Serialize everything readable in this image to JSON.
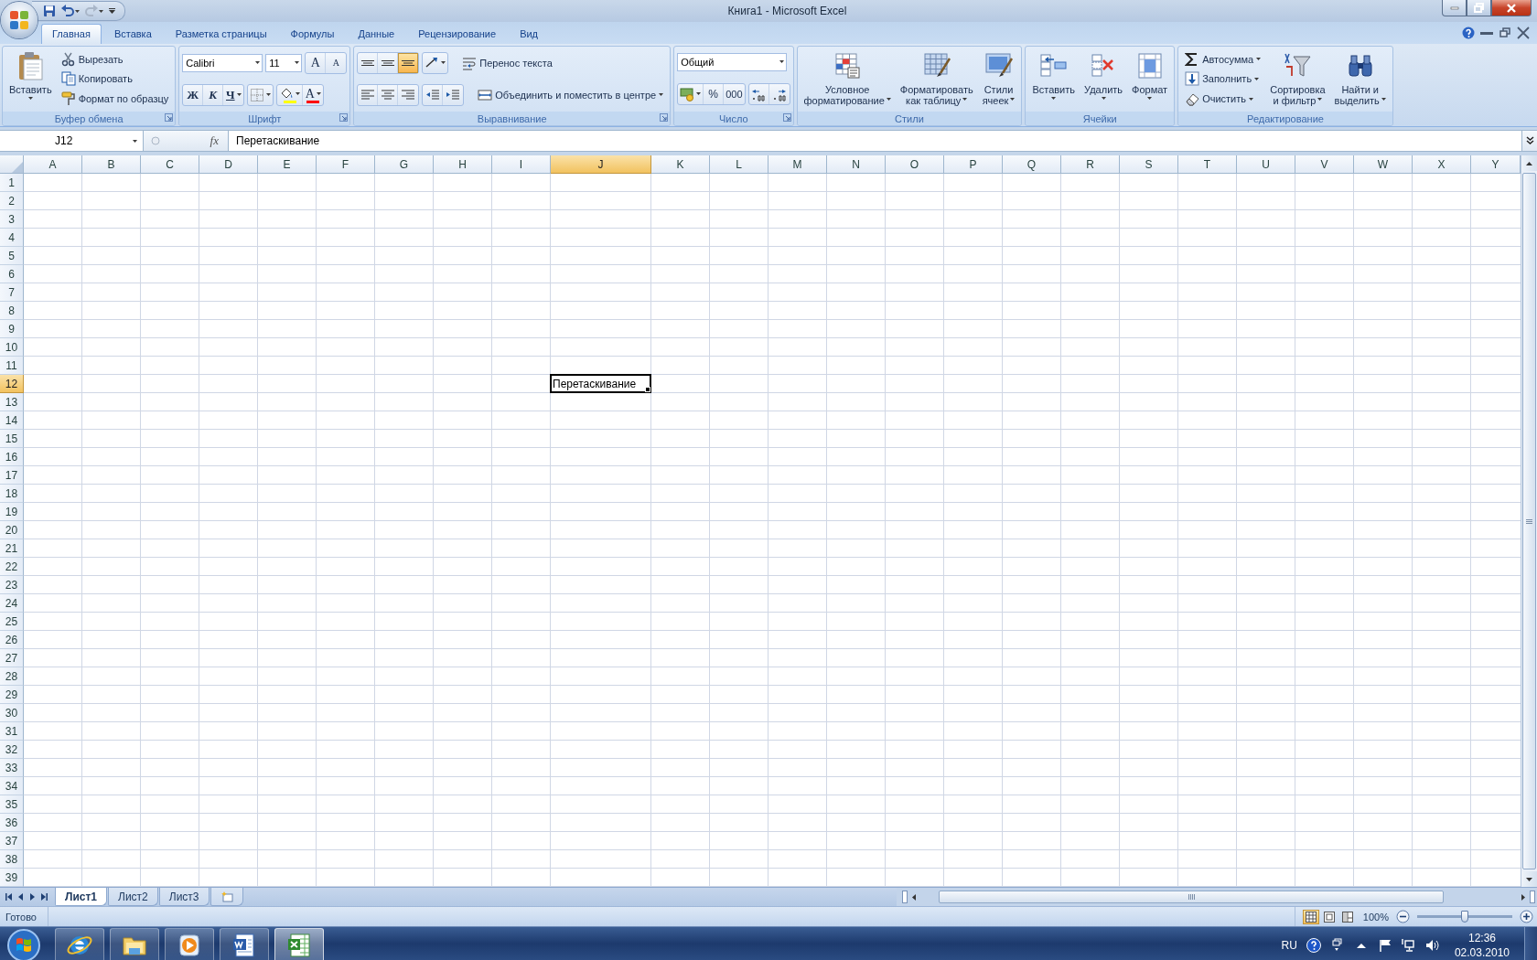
{
  "window": {
    "title": "Книга1 - Microsoft Excel"
  },
  "quick_access": [
    {
      "kind": "save",
      "dropdown": false,
      "disabled": false
    },
    {
      "kind": "undo",
      "dropdown": true,
      "disabled": false
    },
    {
      "kind": "redo",
      "dropdown": true,
      "disabled": true
    }
  ],
  "ribbon_tabs": [
    {
      "label": "Главная",
      "selected": true
    },
    {
      "label": "Вставка",
      "selected": false
    },
    {
      "label": "Разметка страницы",
      "selected": false
    },
    {
      "label": "Формулы",
      "selected": false
    },
    {
      "label": "Данные",
      "selected": false
    },
    {
      "label": "Рецензирование",
      "selected": false
    },
    {
      "label": "Вид",
      "selected": false
    }
  ],
  "ribbon_groups": [
    {
      "label": "Буфер обмена",
      "launcher": true,
      "sections": [
        {
          "kind": "large",
          "lines": [
            "Вставить"
          ],
          "dropdown": true
        },
        {
          "kind": "stack",
          "items": [
            {
              "label": "Вырезать",
              "dropdown": false
            },
            {
              "label": "Копировать",
              "dropdown": false
            },
            {
              "label": "Формат по образцу",
              "dropdown": false
            }
          ]
        }
      ]
    },
    {
      "label": "Шрифт",
      "launcher": true,
      "sections": [
        {
          "kind": "rows",
          "rows": [
            [
              {
                "kind": "combo",
                "value": "Calibri"
              },
              {
                "kind": "combo",
                "value": "11"
              },
              {
                "kind": "tools",
                "tools": [
                  {
                    "text": "A",
                    "dropdown": false,
                    "selected": false
                  },
                  {
                    "text": "A",
                    "dropdown": false,
                    "selected": false
                  }
                ]
              }
            ],
            [
              {
                "kind": "tools",
                "tools": [
                  {
                    "text": "Ж",
                    "dropdown": false,
                    "selected": false
                  },
                  {
                    "text": "К",
                    "dropdown": false,
                    "selected": false
                  },
                  {
                    "text": "Ч",
                    "dropdown": true,
                    "selected": false
                  }
                ]
              },
              {
                "kind": "tools",
                "tools": [
                  {
                    "dropdown": true,
                    "selected": false
                  }
                ]
              },
              {
                "kind": "tools",
                "tools": [
                  {
                    "dropdown": true,
                    "selected": false,
                    "color": "#ffff00"
                  },
                  {
                    "text": "A",
                    "dropdown": true,
                    "selected": false,
                    "color": "#ff0000"
                  }
                ]
              }
            ]
          ]
        }
      ]
    },
    {
      "label": "Выравнивание",
      "launcher": true,
      "sections": [
        {
          "kind": "rows",
          "rows": [
            [
              {
                "kind": "tools",
                "tools": [
                  {
                    "dropdown": false,
                    "selected": false
                  },
                  {
                    "dropdown": false,
                    "selected": false
                  },
                  {
                    "dropdown": false,
                    "selected": true
                  }
                ]
              },
              {
                "kind": "tools",
                "tools": [
                  {
                    "dropdown": true,
                    "selected": false
                  }
                ]
              },
              {
                "kind": "small",
                "label": "Перенос текста",
                "dropdown": false
              }
            ],
            [
              {
                "kind": "tools",
                "tools": [
                  {
                    "dropdown": false,
                    "selected": false
                  },
                  {
                    "dropdown": false,
                    "selected": false
                  },
                  {
                    "dropdown": false,
                    "selected": false
                  }
                ]
              },
              {
                "kind": "tools",
                "tools": [
                  {
                    "dropdown": false,
                    "selected": false
                  },
                  {
                    "dropdown": false,
                    "selected": false
                  }
                ]
              },
              {
                "kind": "small",
                "label": "Объединить и поместить в центре",
                "dropdown": true
              }
            ]
          ]
        }
      ]
    },
    {
      "label": "Число",
      "launcher": true,
      "sections": [
        {
          "kind": "rows",
          "rows": [
            [
              {
                "kind": "combo",
                "value": "Общий"
              }
            ],
            [
              {
                "kind": "tools",
                "tools": [
                  {
                    "dropdown": true,
                    "selected": false
                  },
                  {
                    "text": "%",
                    "dropdown": false,
                    "selected": false
                  },
                  {
                    "text": "000",
                    "dropdown": false,
                    "selected": false
                  }
                ]
              },
              {
                "kind": "tools",
                "tools": [
                  {
                    "dropdown": false,
                    "selected": false
                  },
                  {
                    "dropdown": false,
                    "selected": false
                  }
                ]
              }
            ]
          ]
        }
      ]
    },
    {
      "label": "Стили",
      "launcher": false,
      "sections": [
        {
          "kind": "large",
          "lines": [
            "Условное",
            "форматирование"
          ],
          "dropdown": true
        },
        {
          "kind": "large",
          "lines": [
            "Форматировать",
            "как таблицу"
          ],
          "dropdown": true
        },
        {
          "kind": "large",
          "lines": [
            "Стили",
            "ячеек"
          ],
          "dropdown": true
        }
      ]
    },
    {
      "label": "Ячейки",
      "launcher": false,
      "sections": [
        {
          "kind": "large",
          "lines": [
            "Вставить"
          ],
          "dropdown": true
        },
        {
          "kind": "large",
          "lines": [
            "Удалить"
          ],
          "dropdown": true
        },
        {
          "kind": "large",
          "lines": [
            "Формат"
          ],
          "dropdown": true
        }
      ]
    },
    {
      "label": "Редактирование",
      "launcher": false,
      "sections": [
        {
          "kind": "stack",
          "items": [
            {
              "label": "Автосумма",
              "dropdown": true
            },
            {
              "label": "Заполнить",
              "dropdown": true
            },
            {
              "label": "Очистить",
              "dropdown": true
            }
          ]
        },
        {
          "kind": "large",
          "lines": [
            "Сортировка",
            "и фильтр"
          ],
          "dropdown": true
        },
        {
          "kind": "large",
          "lines": [
            "Найти и",
            "выделить"
          ],
          "dropdown": true
        }
      ]
    }
  ],
  "formula_bar": {
    "name_box": "J12",
    "function_label": "fx",
    "formula": "Перетаскивание"
  },
  "sheet": {
    "columns": [
      {
        "label": "A",
        "selected": false
      },
      {
        "label": "B",
        "selected": false
      },
      {
        "label": "C",
        "selected": false
      },
      {
        "label": "D",
        "selected": false
      },
      {
        "label": "E",
        "selected": false
      },
      {
        "label": "F",
        "selected": false
      },
      {
        "label": "G",
        "selected": false
      },
      {
        "label": "H",
        "selected": false
      },
      {
        "label": "I",
        "selected": false
      },
      {
        "label": "J",
        "selected": true
      },
      {
        "label": "K",
        "selected": false
      },
      {
        "label": "L",
        "selected": false
      },
      {
        "label": "M",
        "selected": false
      },
      {
        "label": "N",
        "selected": false
      },
      {
        "label": "O",
        "selected": false
      },
      {
        "label": "P",
        "selected": false
      },
      {
        "label": "Q",
        "selected": false
      },
      {
        "label": "R",
        "selected": false
      },
      {
        "label": "S",
        "selected": false
      },
      {
        "label": "T",
        "selected": false
      },
      {
        "label": "U",
        "selected": false
      },
      {
        "label": "V",
        "selected": false
      },
      {
        "label": "W",
        "selected": false
      },
      {
        "label": "X",
        "selected": false
      },
      {
        "label": "Y",
        "selected": false
      }
    ],
    "rows": [
      {
        "label": "1",
        "selected": false
      },
      {
        "label": "2",
        "selected": false
      },
      {
        "label": "3",
        "selected": false
      },
      {
        "label": "4",
        "selected": false
      },
      {
        "label": "5",
        "selected": false
      },
      {
        "label": "6",
        "selected": false
      },
      {
        "label": "7",
        "selected": false
      },
      {
        "label": "8",
        "selected": false
      },
      {
        "label": "9",
        "selected": false
      },
      {
        "label": "10",
        "selected": false
      },
      {
        "label": "11",
        "selected": false
      },
      {
        "label": "12",
        "selected": true
      },
      {
        "label": "13",
        "selected": false
      },
      {
        "label": "14",
        "selected": false
      },
      {
        "label": "15",
        "selected": false
      },
      {
        "label": "16",
        "selected": false
      },
      {
        "label": "17",
        "selected": false
      },
      {
        "label": "18",
        "selected": false
      },
      {
        "label": "19",
        "selected": false
      },
      {
        "label": "20",
        "selected": false
      },
      {
        "label": "21",
        "selected": false
      },
      {
        "label": "22",
        "selected": false
      },
      {
        "label": "23",
        "selected": false
      },
      {
        "label": "24",
        "selected": false
      },
      {
        "label": "25",
        "selected": false
      },
      {
        "label": "26",
        "selected": false
      },
      {
        "label": "27",
        "selected": false
      },
      {
        "label": "28",
        "selected": false
      },
      {
        "label": "29",
        "selected": false
      },
      {
        "label": "30",
        "selected": false
      },
      {
        "label": "31",
        "selected": false
      },
      {
        "label": "32",
        "selected": false
      },
      {
        "label": "33",
        "selected": false
      },
      {
        "label": "34",
        "selected": false
      },
      {
        "label": "35",
        "selected": false
      },
      {
        "label": "36",
        "selected": false
      },
      {
        "label": "37",
        "selected": false
      },
      {
        "label": "38",
        "selected": false
      },
      {
        "label": "39",
        "selected": false
      }
    ],
    "active_cell": {
      "text": "Перетаскивание"
    }
  },
  "sheet_tabs": [
    {
      "label": "Лист1",
      "selected": true
    },
    {
      "label": "Лист2",
      "selected": false
    },
    {
      "label": "Лист3",
      "selected": false
    }
  ],
  "status_bar": {
    "status": "Готово",
    "views": [
      {
        "kind": "normal",
        "selected": true
      },
      {
        "kind": "layout",
        "selected": false
      },
      {
        "kind": "break",
        "selected": false
      }
    ],
    "zoom": "100%",
    "zoom_slider": {
      "level": 0.5
    }
  },
  "taskbar": {
    "apps": [
      {
        "kind": "browser",
        "selected": false
      },
      {
        "kind": "folder",
        "selected": false
      },
      {
        "kind": "media",
        "selected": false
      },
      {
        "kind": "word",
        "selected": false
      },
      {
        "kind": "excel",
        "selected": true
      }
    ],
    "language": "RU",
    "time": "12:36",
    "date": "02.03.2010"
  }
}
